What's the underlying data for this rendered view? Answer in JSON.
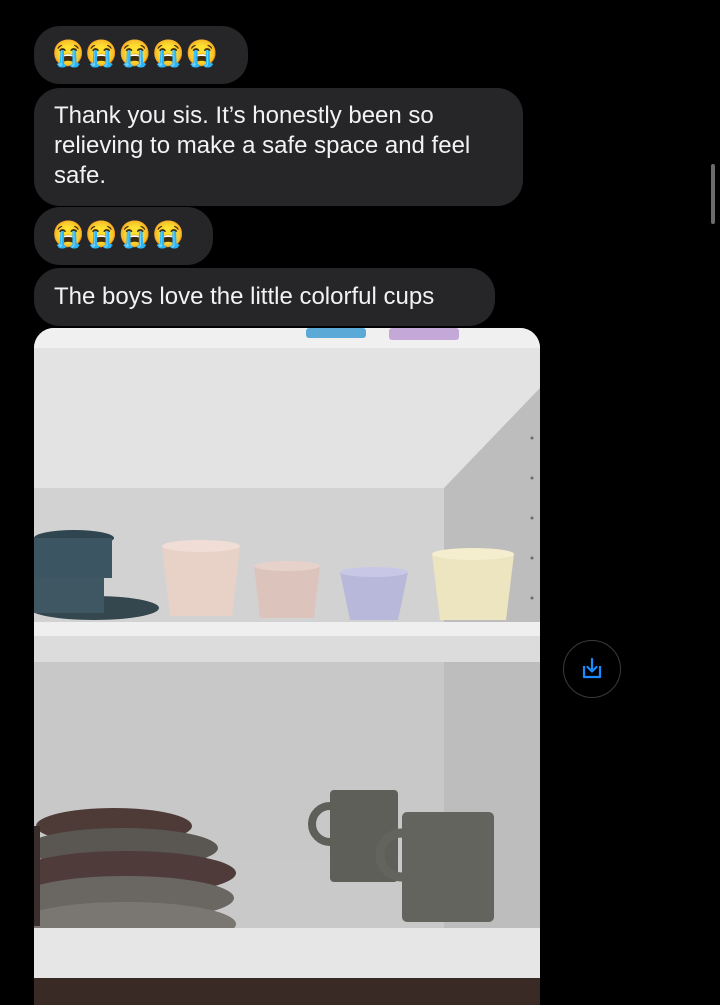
{
  "messages": [
    {
      "kind": "emoji",
      "text": "😭😭😭😭😭"
    },
    {
      "kind": "text",
      "text": "Thank you sis. It’s honestly been so relieving to make a safe space and feel safe."
    },
    {
      "kind": "emoji",
      "text": "😭😭😭😭"
    },
    {
      "kind": "text",
      "text": "The boys love the little colorful cups"
    }
  ],
  "attachment": {
    "type": "photo",
    "cup_colors": [
      "#e8d2c8",
      "#dcc4bc",
      "#b8b8da",
      "#ece5bf"
    ],
    "mug_color": "#5d5f58"
  },
  "actions": {
    "download_icon": "download-arrow-icon",
    "accent": "#1a8cff"
  }
}
